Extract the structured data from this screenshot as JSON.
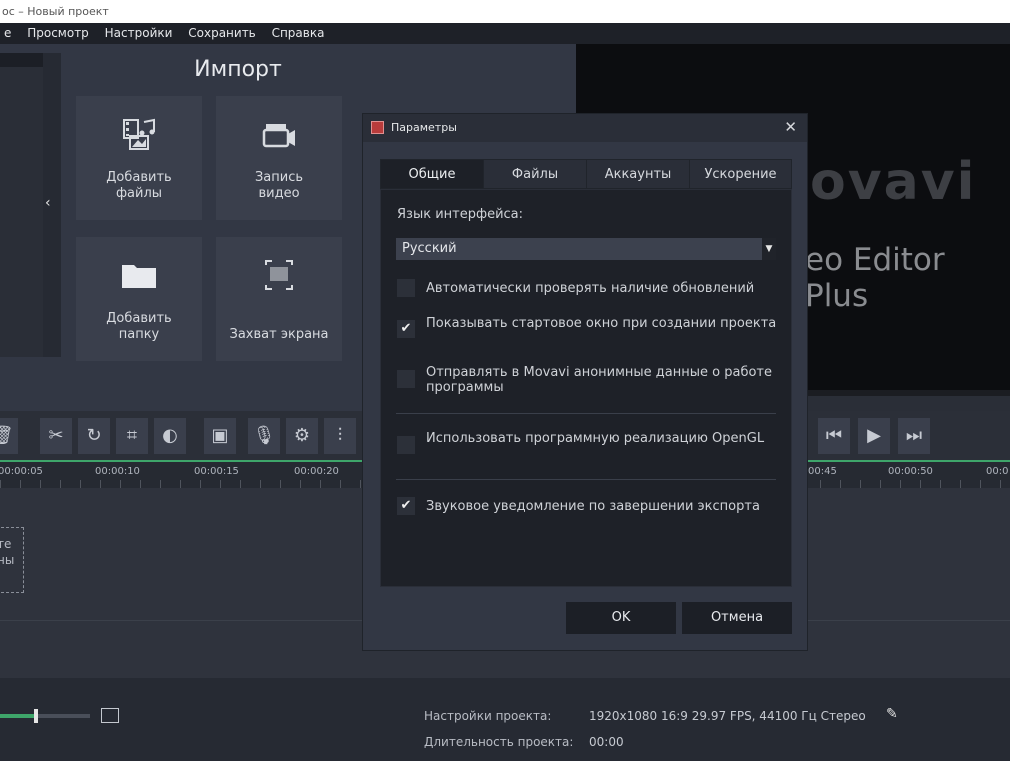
{
  "window": {
    "title": "ос – Новый проект"
  },
  "menu": {
    "items": [
      "е",
      "Просмотр",
      "Настройки",
      "Сохранить",
      "Справка"
    ]
  },
  "import": {
    "title": "Импорт",
    "tiles": [
      {
        "label1": "Добавить",
        "label2": "файлы",
        "icon": "add-files-icon"
      },
      {
        "label1": "Запись",
        "label2": "видео",
        "icon": "video-camera-icon"
      },
      {
        "label1": "Добавить",
        "label2": "папку",
        "icon": "folder-icon"
      },
      {
        "label1": "",
        "label2": "Захват экрана",
        "icon": "screen-capture-icon"
      }
    ],
    "collapse_glyph": "‹"
  },
  "preview": {
    "logo": "ovavi",
    "subtitle": "eo Editor Plus"
  },
  "ruler": {
    "marks": [
      "00:00:05",
      "00:00:10",
      "00:00:15",
      "00:00:20",
      "00:45",
      "00:00:50",
      "00:0"
    ]
  },
  "timeline": {
    "drop_hint1": "те",
    "drop_hint2": "ны"
  },
  "project": {
    "settings_label": "Настройки проекта:",
    "settings_value": "1920x1080 16:9 29.97 FPS, 44100 Гц Стерео",
    "duration_label": "Длительность проекта:",
    "duration_value": "00:00",
    "scale_fraction": 0.4
  },
  "dialog": {
    "title": "Параметры",
    "close_glyph": "✕",
    "tabs": [
      "Общие",
      "Файлы",
      "Аккаунты",
      "Ускорение"
    ],
    "active_tab": "Общие",
    "language_label": "Язык интерфейса:",
    "language_value": "Русский",
    "options": [
      {
        "label": "Автоматически проверять наличие обновлений",
        "checked": false
      },
      {
        "label": "Показывать стартовое окно при создании проекта",
        "checked": true
      },
      {
        "label": "Отправлять в Movavi анонимные данные о работе программы",
        "checked": false
      },
      {
        "label": "Использовать программную реализацию OpenGL",
        "checked": false
      },
      {
        "label": "Звуковое уведомление по завершении экспорта",
        "checked": true
      }
    ],
    "ok_label": "OK",
    "cancel_label": "Отмена"
  }
}
